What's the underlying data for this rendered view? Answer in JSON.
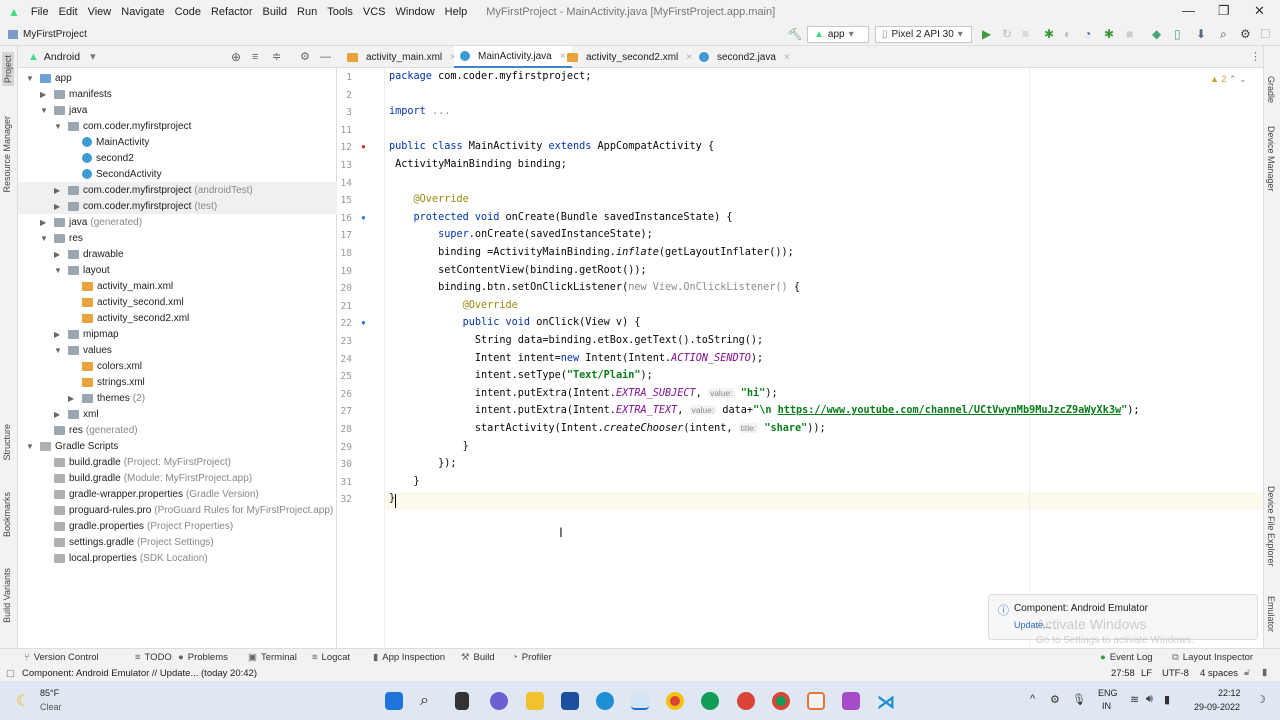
{
  "window": {
    "title": "MyFirstProject - MainActivity.java [MyFirstProject.app.main]",
    "menus": [
      "File",
      "Edit",
      "View",
      "Navigate",
      "Code",
      "Refactor",
      "Build",
      "Run",
      "Tools",
      "VCS",
      "Window",
      "Help"
    ]
  },
  "nav": {
    "breadcrumb": "MyFirstProject",
    "module": "app",
    "device": "Pixel 2 API 30"
  },
  "project": {
    "view": "Android",
    "tree": [
      {
        "l": "app",
        "d": 0,
        "a": "open",
        "i": "fold blue"
      },
      {
        "l": "manifests",
        "d": 1,
        "a": "closed",
        "i": "fold"
      },
      {
        "l": "java",
        "d": 1,
        "a": "open",
        "i": "fold"
      },
      {
        "l": "com.coder.myfirstproject",
        "d": 2,
        "a": "open",
        "i": "fold"
      },
      {
        "l": "MainActivity",
        "d": 3,
        "i": "cls"
      },
      {
        "l": "second2",
        "d": 3,
        "i": "cls"
      },
      {
        "l": "SecondActivity",
        "d": 3,
        "i": "cls"
      },
      {
        "l": "com.coder.myfirstproject",
        "s": "(androidTest)",
        "d": 2,
        "a": "closed",
        "i": "fold",
        "h": true
      },
      {
        "l": "com.coder.myfirstproject",
        "s": "(test)",
        "d": 2,
        "a": "closed",
        "i": "fold",
        "h": true
      },
      {
        "l": "java",
        "s": "(generated)",
        "d": 1,
        "a": "closed",
        "i": "fold"
      },
      {
        "l": "res",
        "d": 1,
        "a": "open",
        "i": "fold"
      },
      {
        "l": "drawable",
        "d": 2,
        "a": "closed",
        "i": "fold"
      },
      {
        "l": "layout",
        "d": 2,
        "a": "open",
        "i": "fold"
      },
      {
        "l": "activity_main.xml",
        "d": 3,
        "i": "xml"
      },
      {
        "l": "activity_second.xml",
        "d": 3,
        "i": "xml"
      },
      {
        "l": "activity_second2.xml",
        "d": 3,
        "i": "xml"
      },
      {
        "l": "mipmap",
        "d": 2,
        "a": "closed",
        "i": "fold"
      },
      {
        "l": "values",
        "d": 2,
        "a": "open",
        "i": "fold"
      },
      {
        "l": "colors.xml",
        "d": 3,
        "i": "xml"
      },
      {
        "l": "strings.xml",
        "d": 3,
        "i": "xml"
      },
      {
        "l": "themes",
        "s": "(2)",
        "d": 3,
        "a": "closed",
        "i": "fold"
      },
      {
        "l": "xml",
        "d": 2,
        "a": "closed",
        "i": "fold"
      },
      {
        "l": "res",
        "s": "(generated)",
        "d": 1,
        "i": "fold"
      },
      {
        "l": "Gradle Scripts",
        "d": 0,
        "a": "open",
        "i": "file"
      },
      {
        "l": "build.gradle",
        "s": "(Project: MyFirstProject)",
        "d": 1,
        "i": "file"
      },
      {
        "l": "build.gradle",
        "s": "(Module: MyFirstProject.app)",
        "d": 1,
        "i": "file"
      },
      {
        "l": "gradle-wrapper.properties",
        "s": "(Gradle Version)",
        "d": 1,
        "i": "file"
      },
      {
        "l": "proguard-rules.pro",
        "s": "(ProGuard Rules for MyFirstProject.app)",
        "d": 1,
        "i": "file"
      },
      {
        "l": "gradle.properties",
        "s": "(Project Properties)",
        "d": 1,
        "i": "file"
      },
      {
        "l": "settings.gradle",
        "s": "(Project Settings)",
        "d": 1,
        "i": "file"
      },
      {
        "l": "local.properties",
        "s": "(SDK Location)",
        "d": 1,
        "i": "file"
      }
    ]
  },
  "tabs": [
    {
      "label": "activity_main.xml",
      "type": "xml"
    },
    {
      "label": "MainActivity.java",
      "type": "cls",
      "active": true
    },
    {
      "label": "activity_second2.xml",
      "type": "xml"
    },
    {
      "label": "second2.java",
      "type": "cls"
    }
  ],
  "editor": {
    "warnings": "2",
    "lines": [
      {
        "n": "1",
        "s": [
          [
            "package ",
            "kw"
          ],
          [
            "com.coder.myfirstproject;",
            ""
          ]
        ]
      },
      {
        "n": "2",
        "s": []
      },
      {
        "n": "3",
        "s": [
          [
            "import ",
            "kw"
          ],
          [
            "...",
            "gr"
          ]
        ]
      },
      {
        "n": "11",
        "s": []
      },
      {
        "n": "12",
        "s": [
          [
            "public class ",
            "kw"
          ],
          [
            "MainActivity ",
            ""
          ],
          [
            "extends ",
            "kw"
          ],
          [
            "AppCompatActivity {",
            ""
          ]
        ]
      },
      {
        "n": "13",
        "s": [
          [
            " ActivityMainBinding binding;",
            ""
          ]
        ]
      },
      {
        "n": "14",
        "s": []
      },
      {
        "n": "15",
        "s": [
          [
            "    @Override",
            "ann"
          ]
        ]
      },
      {
        "n": "16",
        "s": [
          [
            "    protected void ",
            "kw"
          ],
          [
            "onCreate(Bundle savedInstanceState) {",
            ""
          ]
        ]
      },
      {
        "n": "17",
        "s": [
          [
            "        super",
            "kw"
          ],
          [
            ".onCreate(savedInstanceState);",
            ""
          ]
        ]
      },
      {
        "n": "18",
        "s": [
          [
            "        binding =ActivityMainBinding.",
            ""
          ],
          [
            "inflate",
            "fn"
          ],
          [
            "(getLayoutInflater());",
            ""
          ]
        ]
      },
      {
        "n": "19",
        "s": [
          [
            "        setContentView(binding.getRoot());",
            ""
          ]
        ]
      },
      {
        "n": "20",
        "s": [
          [
            "        binding.btn.setOnClickListener(",
            ""
          ],
          [
            "new View.OnClickListener() ",
            "gr"
          ],
          [
            "{",
            ""
          ]
        ]
      },
      {
        "n": "21",
        "s": [
          [
            "            @Override",
            "ann"
          ]
        ]
      },
      {
        "n": "22",
        "s": [
          [
            "            public void ",
            "kw"
          ],
          [
            "onClick(View v) {",
            ""
          ]
        ]
      },
      {
        "n": "23",
        "s": [
          [
            "              String data=binding.etBox.getText().toString();",
            ""
          ]
        ]
      },
      {
        "n": "24",
        "s": [
          [
            "              Intent intent=",
            ""
          ],
          [
            "new ",
            "kw"
          ],
          [
            "Intent(Intent.",
            ""
          ],
          [
            "ACTION_SENDTO",
            "it"
          ],
          [
            ");",
            ""
          ]
        ]
      },
      {
        "n": "25",
        "s": [
          [
            "              intent.setType(",
            ""
          ],
          [
            "\"Text/Plain\"",
            "str"
          ],
          [
            ");",
            ""
          ]
        ]
      },
      {
        "n": "26",
        "s": [
          [
            "              intent.putExtra(Intent.",
            ""
          ],
          [
            "EXTRA_SUBJECT",
            "it"
          ],
          [
            ", ",
            ""
          ],
          [
            "value:",
            "hint"
          ],
          [
            " ",
            ""
          ],
          [
            "\"hi\"",
            "str"
          ],
          [
            ");",
            ""
          ]
        ]
      },
      {
        "n": "27",
        "s": [
          [
            "              intent.putExtra(Intent.",
            ""
          ],
          [
            "EXTRA_TEXT",
            "it"
          ],
          [
            ", ",
            ""
          ],
          [
            "value:",
            "hint"
          ],
          [
            " data+",
            ""
          ],
          [
            "\"\\n ",
            "str"
          ],
          [
            "https://www.youtube.com/channel/UCtVwynMb9MuJzcZ9aWyXk3w",
            "url"
          ],
          [
            "\"",
            "str"
          ],
          [
            ");",
            ""
          ]
        ]
      },
      {
        "n": "28",
        "s": [
          [
            "              startActivity(Intent.",
            ""
          ],
          [
            "createChooser",
            "fn"
          ],
          [
            "(intent, ",
            ""
          ],
          [
            "title:",
            "hint"
          ],
          [
            " ",
            ""
          ],
          [
            "\"share\"",
            "str"
          ],
          [
            "));",
            ""
          ]
        ]
      },
      {
        "n": "29",
        "s": [
          [
            "            }",
            ""
          ]
        ]
      },
      {
        "n": "30",
        "s": [
          [
            "        });",
            ""
          ]
        ]
      },
      {
        "n": "31",
        "s": [
          [
            "    }",
            ""
          ]
        ]
      },
      {
        "n": "32",
        "s": [
          [
            "}",
            ""
          ]
        ]
      }
    ]
  },
  "notification": {
    "title": "Component: Android Emulator",
    "link": "Update...",
    "watermark1": "Activate Windows",
    "watermark2": "Go to Settings to activate Windows."
  },
  "sidestripe": {
    "left": [
      "Project",
      "Resource Manager",
      "Structure",
      "Bookmarks",
      "Build Variants"
    ],
    "right": [
      "Gradle",
      "Device Manager",
      "Device File Explorer",
      "Emulator"
    ]
  },
  "toolwindows": [
    "Version Control",
    "TODO",
    "Problems",
    "Terminal",
    "Logcat",
    "App Inspection",
    "Build",
    "Profiler"
  ],
  "toolwindows_right": [
    "Event Log",
    "Layout Inspector"
  ],
  "status": {
    "message": "Component: Android Emulator // Update... (today 20:42)",
    "position": "27:58",
    "eol": "LF",
    "encoding": "UTF-8",
    "indent": "4 spaces"
  },
  "taskbar": {
    "temp": "85°F",
    "weather": "Clear",
    "lang1": "ENG",
    "lang2": "IN",
    "time": "22:12",
    "date": "29-09-2022"
  }
}
